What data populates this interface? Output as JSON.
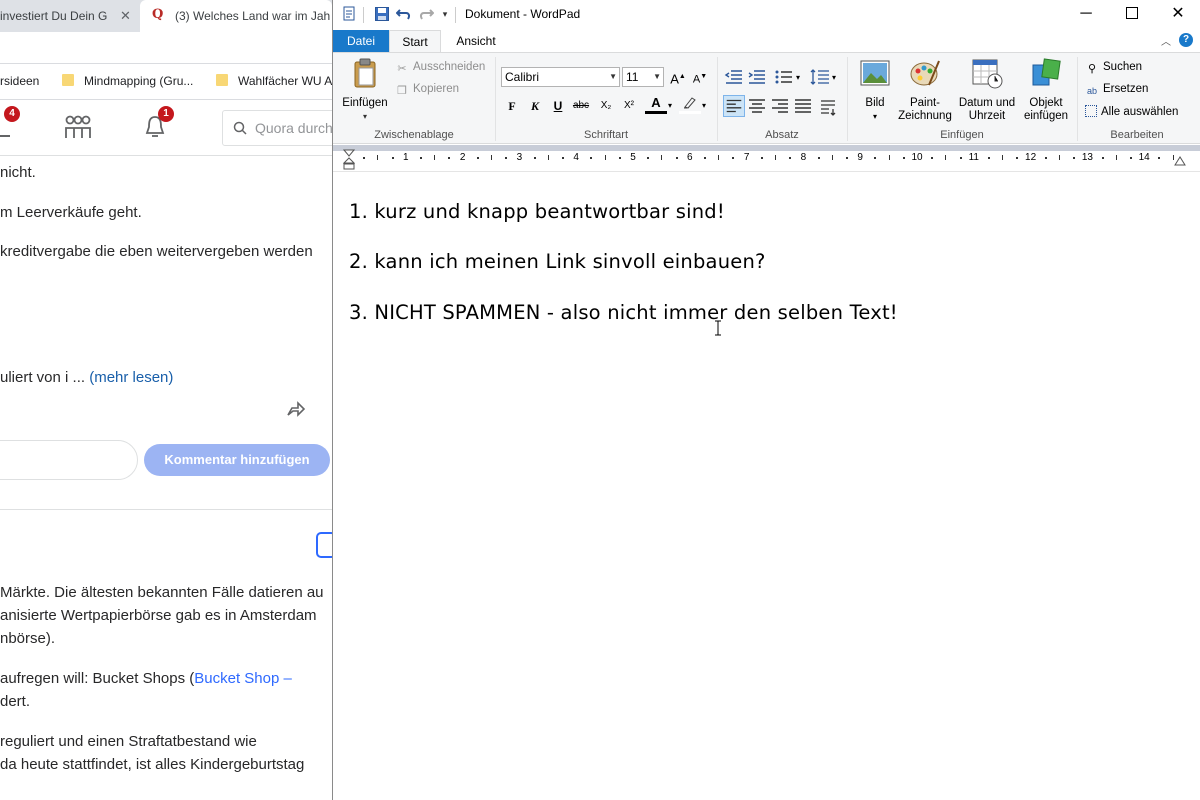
{
  "browser": {
    "tabs": [
      {
        "label": "investiert Du Dein G",
        "close": "✕"
      },
      {
        "label": "(3) Welches Land war im Jah",
        "favicon": "Q"
      }
    ],
    "bookmarks": [
      "rsideen",
      "Mindmapping  (Gru...",
      "Wahlfächer WU A"
    ],
    "header": {
      "notify_badge_1": "4",
      "notify_badge_2": "1",
      "search_placeholder": "Quora durch"
    },
    "content": {
      "line1": "nicht.",
      "line2": "m Leerverkäufe geht.",
      "line3": "kreditvergabe die eben weitervergeben werden",
      "line4_prefix": "uliert von i ... ",
      "line4_link": "(mehr lesen)",
      "comment_button": "Kommentar hinzufügen",
      "para1": "Märkte. Die ältesten bekannten Fälle datieren au",
      "para2": "anisierte Wertpapierbörse gab es in Amsterdam",
      "para3": "nbörse).",
      "para4_prefix": "aufregen will: Bucket Shops (",
      "para4_link": "Bucket Shop –",
      "para5": "dert.",
      "para6": "reguliert und einen Straftatbestand wie",
      "para7": " da heute stattfindet, ist alles Kindergeburtstag"
    }
  },
  "wordpad": {
    "title": "Dokument - WordPad",
    "ribbon_tabs": {
      "file": "Datei",
      "start": "Start",
      "view": "Ansicht"
    },
    "clipboard": {
      "paste": "Einfügen",
      "cut": "Ausschneiden",
      "copy": "Kopieren",
      "label": "Zwischenablage"
    },
    "font": {
      "family": "Calibri",
      "size": "11",
      "bold": "F",
      "italic": "K",
      "underline": "U",
      "strike": "abc",
      "sub": "X₂",
      "sup": "X²",
      "color_letter": "A",
      "label": "Schriftart"
    },
    "paragraph": {
      "label": "Absatz"
    },
    "insert": {
      "picture": "Bild",
      "paint_1": "Paint-",
      "paint_2": "Zeichnung",
      "datetime_1": "Datum und",
      "datetime_2": "Uhrzeit",
      "object_1": "Objekt",
      "object_2": "einfügen",
      "label": "Einfügen"
    },
    "edit": {
      "find": "Suchen",
      "replace": "Ersetzen",
      "select_all": "Alle auswählen",
      "label": "Bearbeiten"
    },
    "ruler_numbers": [
      "1",
      "2",
      "3",
      "4",
      "5",
      "6",
      "7",
      "8",
      "9",
      "10",
      "11",
      "12",
      "13",
      "14"
    ],
    "document_lines": [
      "1. kurz und knapp beantwortbar sind!",
      "2. kann ich meinen Link sinvoll einbauen?",
      "3. NICHT SPAMMEN - also nicht immer den selben Text!"
    ],
    "colors": {
      "file_tab": "#1979ca",
      "ribbon_bg": "#f5f6f7",
      "selected_button": "#cce4f7"
    }
  }
}
